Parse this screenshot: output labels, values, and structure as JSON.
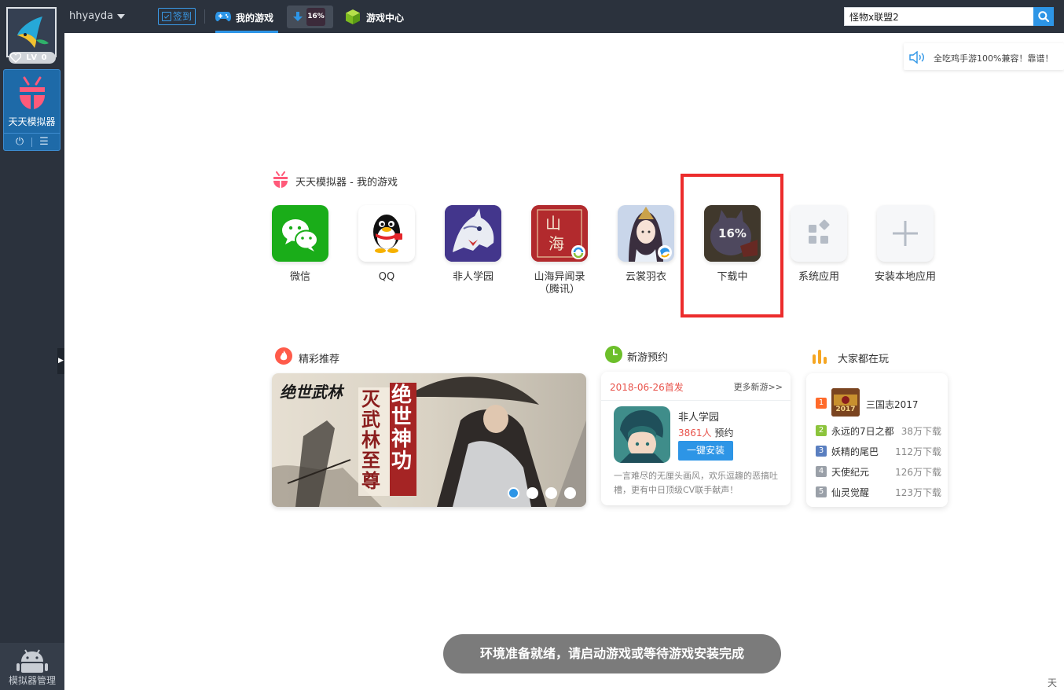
{
  "sidebar": {
    "level": "LV 0",
    "emulator_label": "天天模拟器",
    "manager_label": "模拟器管理",
    "power_icon": "power-icon",
    "menu_icon": "menu-icon"
  },
  "topbar": {
    "username": "hhyayda",
    "signin_label": "签到",
    "tab_mygames": "我的游戏",
    "download_percent": "16%",
    "tab_gamecenter": "游戏中心",
    "search_value": "怪物x联盟2",
    "accent": "#2d95e6"
  },
  "ticker": {
    "text": "全吃鸡手游100%兼容！靠谱！"
  },
  "mygames": {
    "title": "天天模拟器 - 我的游戏",
    "apps": [
      {
        "name": "微信"
      },
      {
        "name": "QQ"
      },
      {
        "name": "非人学园"
      },
      {
        "name": "山海异闻录（腾讯）"
      },
      {
        "name": "云裳羽衣"
      },
      {
        "name": "下载中",
        "percent": "16%",
        "progress": 0.16
      },
      {
        "name": "系统应用"
      },
      {
        "name": "安装本地应用"
      }
    ]
  },
  "featured": {
    "title": "精彩推荐",
    "banner_text_main": "绝世神功",
    "banner_text_sub": "灭武林至尊",
    "banner_logo": "绝世武林",
    "slides_total": 4,
    "slide_active": 1
  },
  "newgame": {
    "title": "新游预约",
    "date": "2018-06-26首发",
    "more": "更多新游>>",
    "game_name": "非人学园",
    "count_num": "3861人",
    "count_suffix": " 预约",
    "install": "一键安装",
    "desc": "一言难尽的无厘头画风，欢乐逗趣的恶搞吐槽，更有中日顶级CV联手献声！"
  },
  "popular": {
    "title": "大家都在玩",
    "top": {
      "rank": "1",
      "name": "三国志2017",
      "badge": "2017"
    },
    "rows": [
      {
        "rank": "2",
        "name": "永远的7日之都",
        "downloads": "38万下载",
        "color": "#8cc43c"
      },
      {
        "rank": "3",
        "name": "妖精的尾巴",
        "downloads": "112万下载",
        "color": "#5a7fc0"
      },
      {
        "rank": "4",
        "name": "天使纪元",
        "downloads": "126万下载",
        "color": "#9aa0a8"
      },
      {
        "rank": "5",
        "name": "仙灵觉醒",
        "downloads": "123万下载",
        "color": "#9aa0a8"
      }
    ]
  },
  "toast": "环境准备就绪，请启动游戏或等待游戏安装完成",
  "corner_text": "天天"
}
